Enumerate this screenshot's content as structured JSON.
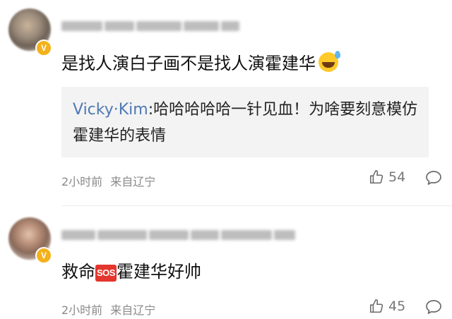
{
  "comments": [
    {
      "content": "是找人演白子画不是找人演霍建华",
      "emoji": "grinning-sweat-emoji",
      "quote": {
        "user": "Vicky·Kim",
        "text": ":哈哈哈哈哈一针见血！为啥要刻意模仿霍建华的表情"
      },
      "time": "2小时前",
      "source": "来自辽宁",
      "likes": "54"
    },
    {
      "content_before": "救命",
      "sos": "SOS",
      "content_after": "霍建华好帅",
      "time": "2小时前",
      "source": "来自辽宁",
      "likes": "45"
    }
  ],
  "badge": "V"
}
